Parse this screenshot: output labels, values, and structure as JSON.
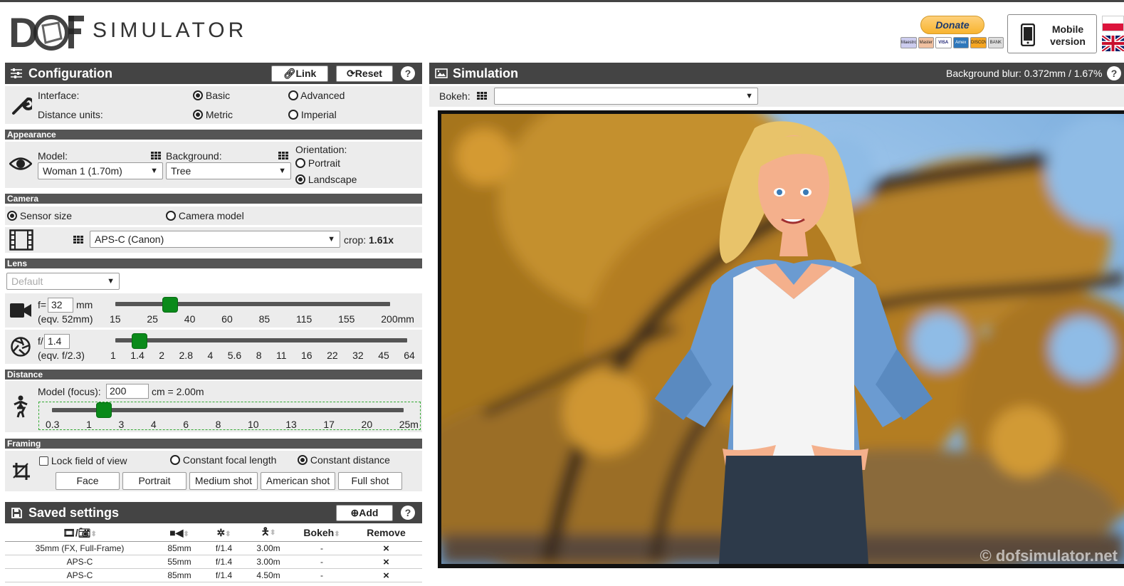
{
  "header": {
    "logo_text": "SIMULATOR",
    "donate_label": "Donate",
    "card_labels": [
      "Maestro",
      "Master",
      "VISA",
      "Amex",
      "DISCOVER",
      "BANK"
    ],
    "mobile_label_1": "Mobile",
    "mobile_label_2": "version"
  },
  "config": {
    "title": "Configuration",
    "link_label": "Link",
    "reset_label": "Reset",
    "help": "?",
    "interface_label": "Interface:",
    "interface_options": [
      "Basic",
      "Advanced"
    ],
    "distance_units_label": "Distance units:",
    "distance_units_options": [
      "Metric",
      "Imperial"
    ]
  },
  "appearance": {
    "section": "Appearance",
    "model_label": "Model:",
    "model_value": "Woman 1 (1.70m)",
    "background_label": "Background:",
    "background_value": "Tree",
    "orientation_label": "Orientation:",
    "orientation_options": [
      "Portrait",
      "Landscape"
    ]
  },
  "camera": {
    "section": "Camera",
    "mode_options": [
      "Sensor size",
      "Camera model"
    ],
    "sensor_value": "APS-C (Canon)",
    "crop_label": "crop:",
    "crop_value": "1.61x"
  },
  "lens": {
    "section": "Lens",
    "preset_value": "Default",
    "focal_prefix": "f=",
    "focal_value": "32",
    "focal_unit": "mm",
    "focal_eqv": "(eqv. 52mm)",
    "focal_ticks": [
      "15",
      "25",
      "40",
      "60",
      "85",
      "115",
      "155",
      "200mm"
    ],
    "aperture_prefix": "f/",
    "aperture_value": "1.4",
    "aperture_eqv": "(eqv. f/2.3)",
    "aperture_ticks": [
      "1",
      "1.4",
      "2",
      "2.8",
      "4",
      "5.6",
      "8",
      "11",
      "16",
      "22",
      "32",
      "45",
      "64"
    ]
  },
  "distance": {
    "section": "Distance",
    "focus_label": "Model (focus):",
    "focus_value": "200",
    "focus_suffix": "cm = 2.00m",
    "ticks": [
      "0.3",
      "1",
      "3",
      "4",
      "6",
      "8",
      "10",
      "13",
      "17",
      "20",
      "25m"
    ]
  },
  "framing": {
    "section": "Framing",
    "lock_label": "Lock field of view",
    "mode_options": [
      "Constant focal length",
      "Constant distance"
    ],
    "buttons": [
      "Face",
      "Portrait",
      "Medium shot",
      "American shot",
      "Full shot"
    ]
  },
  "saved": {
    "title": "Saved settings",
    "add_label": "Add",
    "help": "?",
    "col_bokeh": "Bokeh",
    "col_remove": "Remove",
    "rows": [
      {
        "sensor": "35mm (FX, Full-Frame)",
        "focal": "85mm",
        "aperture": "f/1.4",
        "distance": "3.00m",
        "bokeh": "-",
        "remove": "×"
      },
      {
        "sensor": "APS-C",
        "focal": "55mm",
        "aperture": "f/1.4",
        "distance": "3.00m",
        "bokeh": "-",
        "remove": "×"
      },
      {
        "sensor": "APS-C",
        "focal": "85mm",
        "aperture": "f/1.4",
        "distance": "4.50m",
        "bokeh": "-",
        "remove": "×"
      }
    ]
  },
  "simulation": {
    "title": "Simulation",
    "blur_info": "Background blur: 0.372mm / 1.67%",
    "help": "?",
    "bokeh_label": "Bokeh:",
    "bokeh_value": "",
    "watermark": "© dofsimulator.net"
  },
  "controls": {
    "focal_fraction": 0.2,
    "aperture_fraction": 0.082,
    "distance_fraction": 0.147
  },
  "colors": {
    "header_bg": "#444444",
    "slider_thumb": "#0a8a1a",
    "sky": "#7fb6e6",
    "foliage": "#c08a2a"
  }
}
